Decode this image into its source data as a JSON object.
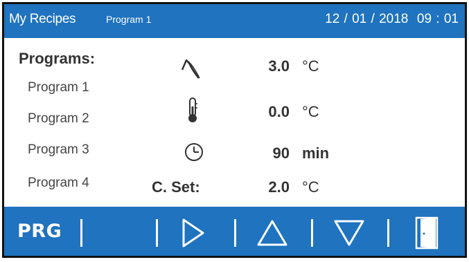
{
  "header": {
    "app_title": "My Recipes",
    "program_name": "Program 1",
    "datetime": "12 / 01 / 2018  09 : 01"
  },
  "programs": {
    "heading": "Programs:",
    "items": [
      "Program 1",
      "Program 2",
      "Program 3",
      "Program 4"
    ]
  },
  "parameters": {
    "ramp": {
      "icon": "ramp-icon",
      "value": "3.0",
      "unit": "°C"
    },
    "temperature": {
      "icon": "thermometer-icon",
      "value": "0.0",
      "unit": "°C"
    },
    "time": {
      "icon": "clock-icon",
      "value": "90",
      "unit": "min"
    },
    "cset": {
      "label": "C. Set:",
      "value": "2.0",
      "unit": "°C"
    }
  },
  "toolbar": {
    "prg_label": "PRG",
    "buttons": [
      "play-icon",
      "up-arrow-icon",
      "down-arrow-icon",
      "exit-door-icon"
    ]
  },
  "colors": {
    "accent": "#1f73bf",
    "text": "#333333",
    "background": "#ffffff"
  }
}
